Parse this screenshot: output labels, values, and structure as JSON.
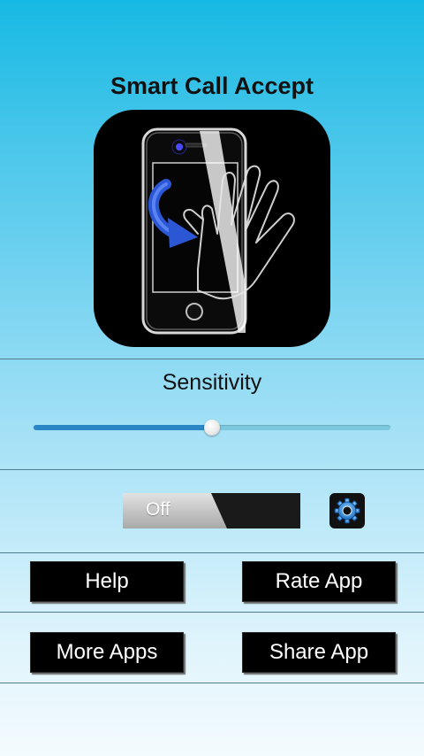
{
  "app": {
    "title": "Smart Call Accept",
    "icon": "phone-hand-wave-icon"
  },
  "sensitivity": {
    "label": "Sensitivity",
    "value_fraction": 0.5
  },
  "service_toggle": {
    "label": "Off",
    "state": "off"
  },
  "settings": {
    "icon": "gear-icon"
  },
  "buttons": {
    "help": "Help",
    "rate_app": "Rate App",
    "more_apps": "More Apps",
    "share_app": "Share App"
  },
  "colors": {
    "slider_fill": "#2a86c4",
    "slider_track": "#7cc9df",
    "button_bg": "#000000",
    "button_text": "#ffffff"
  }
}
